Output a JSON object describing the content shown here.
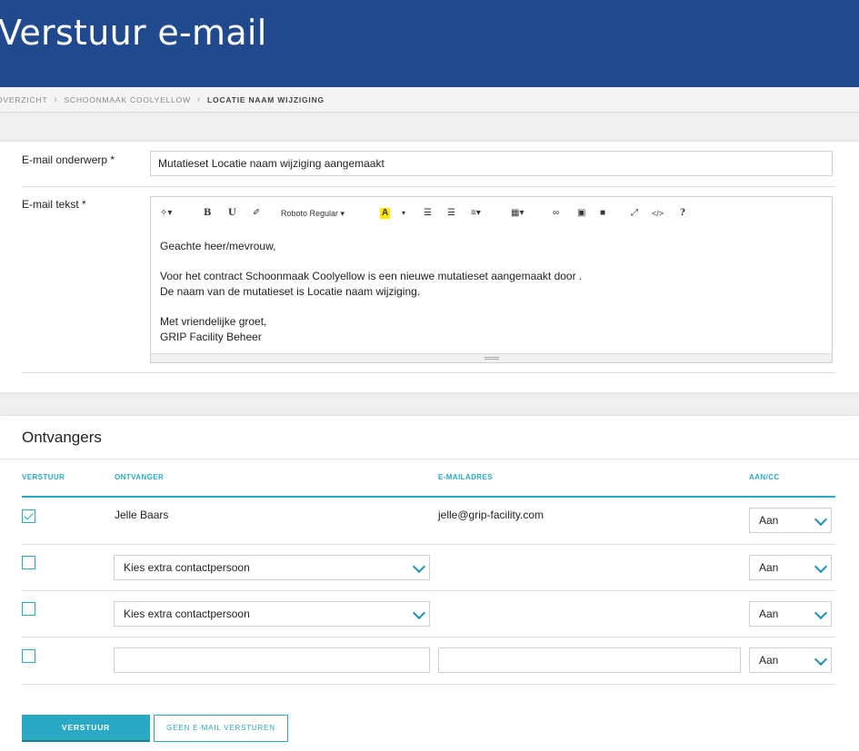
{
  "header": {
    "title": "Verstuur e-mail"
  },
  "breadcrumb": {
    "items": [
      "OVERZICHT",
      "SCHOONMAAK COOLYELLOW",
      "LOCATIE NAAM WIJZIGING"
    ]
  },
  "form": {
    "subject_label": "E-mail onderwerp *",
    "subject_value": "Mutatieset Locatie naam wijziging aangemaakt",
    "body_label": "E-mail tekst *",
    "toolbar": {
      "font_name": "Roboto Regular",
      "bold": "B",
      "underline": "U",
      "highlight": "A",
      "help": "?"
    },
    "body": {
      "greeting": "Geachte heer/mevrouw,",
      "line1": "Voor het contract Schoonmaak Coolyellow is een nieuwe mutatieset aangemaakt door .",
      "line2": "De naam van de mutatieset is Locatie naam wijziging.",
      "closing1": "Met vriendelijke groet,",
      "closing2": "GRIP Facility Beheer"
    }
  },
  "recipients": {
    "title": "Ontvangers",
    "columns": {
      "send": "VERSTUUR",
      "recipient": "ONTVANGER",
      "email": "E-MAILADRES",
      "to_cc": "AAN/CC"
    },
    "rows": [
      {
        "checked": true,
        "name": "Jelle Baars",
        "email": "jelle@grip-facility.com",
        "to_cc": "Aan"
      },
      {
        "checked": false,
        "contact_placeholder": "Kies extra contactpersoon",
        "to_cc": "Aan"
      },
      {
        "checked": false,
        "contact_placeholder": "Kies extra contactpersoon",
        "to_cc": "Aan"
      },
      {
        "checked": false,
        "name": "",
        "email": "",
        "to_cc": "Aan"
      }
    ]
  },
  "actions": {
    "send_label": "VERSTUUR",
    "skip_label": "GEEN E-MAIL VERSTUREN"
  },
  "colors": {
    "header": "#214a8e",
    "accent": "#2aa8c4"
  }
}
